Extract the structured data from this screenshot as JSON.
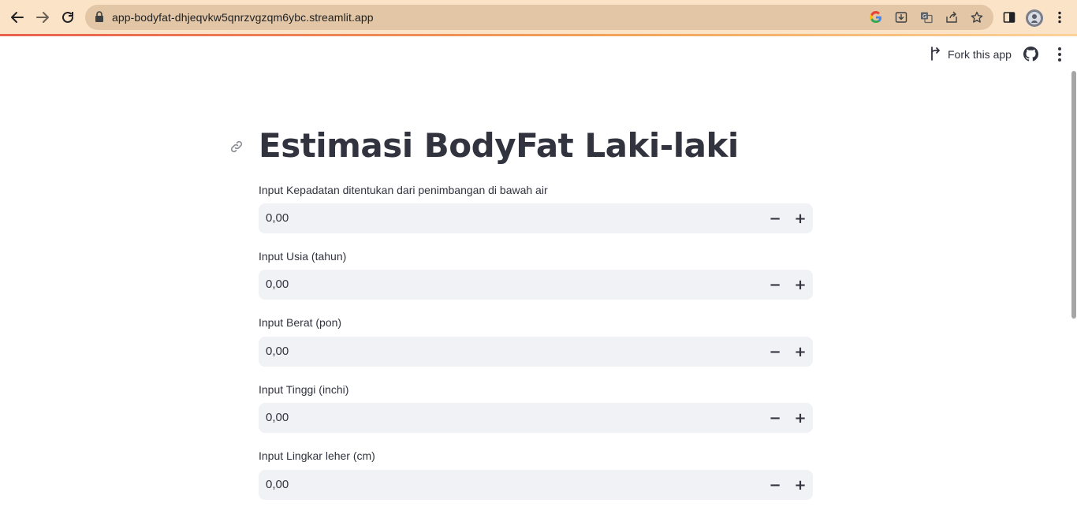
{
  "browser": {
    "url": "app-bodyfat-dhjeqvkw5qnrzvgzqm6ybc.streamlit.app",
    "icons": [
      "back-icon",
      "forward-icon",
      "reload-icon",
      "lock-icon",
      "google-icon",
      "install-icon",
      "translate-icon",
      "share-icon",
      "bookmark-star-icon",
      "side-panel-icon",
      "profile-avatar",
      "kebab-menu-icon"
    ]
  },
  "header": {
    "fork_label": "Fork this app",
    "icons": [
      "fork-icon",
      "github-icon",
      "main-menu-icon"
    ]
  },
  "main": {
    "title": "Estimasi BodyFat Laki-laki",
    "fields": [
      {
        "label": "Input Kepadatan ditentukan dari penimbangan di bawah air",
        "value": "0,00",
        "minus": "−",
        "plus": "+"
      },
      {
        "label": "Input Usia (tahun)",
        "value": "0,00",
        "minus": "−",
        "plus": "+"
      },
      {
        "label": "Input Berat (pon)",
        "value": "0,00",
        "minus": "−",
        "plus": "+"
      },
      {
        "label": "Input Tinggi (inchi)",
        "value": "0,00",
        "minus": "−",
        "plus": "+"
      },
      {
        "label": "Input Lingkar leher (cm)",
        "value": "0,00",
        "minus": "−",
        "plus": "+"
      }
    ]
  },
  "colors": {
    "browser_bar": "#fbe3c8",
    "omnibox": "#e2c6a5",
    "input_bg": "#f0f2f6",
    "text": "#31333f"
  }
}
